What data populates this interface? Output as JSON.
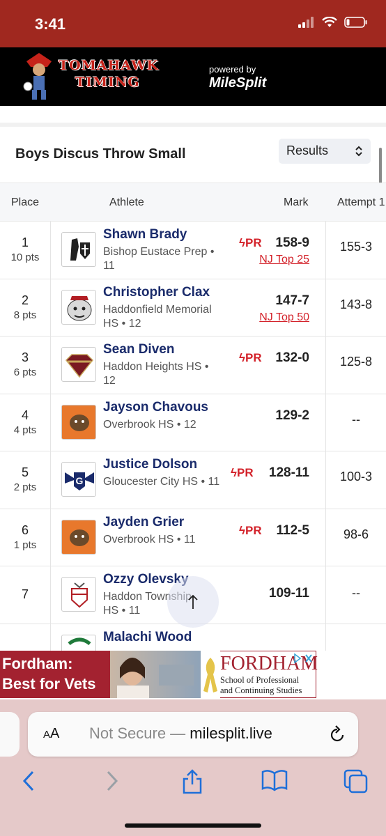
{
  "status": {
    "time": "3:41"
  },
  "banner": {
    "logo_line1": "TOMAHAWK",
    "logo_line2": "TIMING",
    "powered_by": "powered by",
    "milesplit": "MileSplit"
  },
  "event": {
    "title": "Boys Discus Throw Small",
    "view_select": "Results"
  },
  "table": {
    "headers": {
      "place": "Place",
      "athlete": "Athlete",
      "mark": "Mark",
      "attempt": "Attempt 1"
    },
    "rows": [
      {
        "place": "1",
        "pts": "10 pts",
        "name": "Shawn Brady",
        "school": "Bishop Eustace Prep • 11",
        "pr": "PR",
        "mark": "158-9",
        "top": "NJ Top 25",
        "attempt": "155-3",
        "logo": "crusader-knight-logo"
      },
      {
        "place": "2",
        "pts": "8 pts",
        "name": "Christopher Clax",
        "school": "Haddonfield Memorial HS • 12",
        "pr": "",
        "mark": "147-7",
        "top": "NJ Top 50",
        "attempt": "143-8",
        "logo": "bulldog-logo"
      },
      {
        "place": "3",
        "pts": "6 pts",
        "name": "Sean Diven",
        "school": "Haddon Heights HS • 12",
        "pr": "PR",
        "mark": "132-0",
        "top": "",
        "attempt": "125-8",
        "logo": "garnets-gem-logo"
      },
      {
        "place": "4",
        "pts": "4 pts",
        "name": "Jayson Chavous",
        "school": "Overbrook HS • 12",
        "pr": "",
        "mark": "129-2",
        "top": "",
        "attempt": "--",
        "logo": "overbrook-bulldog-logo"
      },
      {
        "place": "5",
        "pts": "2 pts",
        "name": "Justice Dolson",
        "school": "Gloucester City HS • 11",
        "pr": "PR",
        "mark": "128-11",
        "top": "",
        "attempt": "100-3",
        "logo": "gloucester-lions-logo"
      },
      {
        "place": "6",
        "pts": "1 pts",
        "name": "Jayden Grier",
        "school": "Overbrook HS • 11",
        "pr": "PR",
        "mark": "112-5",
        "top": "",
        "attempt": "98-6",
        "logo": "overbrook-bulldog-logo"
      },
      {
        "place": "7",
        "pts": "",
        "name": "Ozzy Olevsky",
        "school": "Haddon Township HS • 11",
        "pr": "",
        "mark": "109-11",
        "top": "",
        "attempt": "--",
        "logo": "haddon-township-crest-logo"
      },
      {
        "place": "",
        "pts": "",
        "name": "Malachi Wood",
        "school": "",
        "pr": "",
        "mark": "",
        "top": "",
        "attempt": "",
        "logo": "green-logo"
      }
    ]
  },
  "ad": {
    "left_line1": "Fordham:",
    "left_line2": "Best for Vets",
    "brand": "FORDHAM",
    "sub_line1": "School of Professional",
    "sub_line2": "and Continuing Studies"
  },
  "browser": {
    "aa": "AA",
    "not_secure": "Not Secure —",
    "domain": "milesplit.live"
  },
  "colors": {
    "status_bar": "#a0281f",
    "athlete_name": "#1a2b6b",
    "pr_red": "#d3222a",
    "toolbar": "#e5c9c9",
    "nav_blue": "#1e6fd9"
  }
}
